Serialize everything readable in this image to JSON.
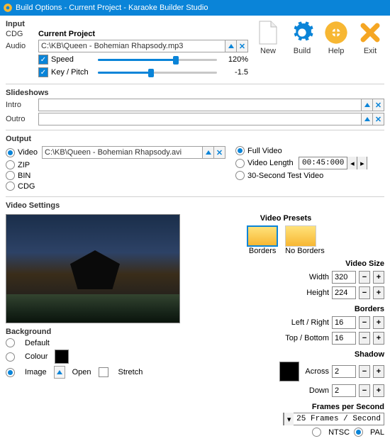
{
  "window": {
    "title": "Build Options - Current Project - Karaoke Builder Studio"
  },
  "toolbar": {
    "new": "New",
    "build": "Build",
    "help": "Help",
    "exit": "Exit"
  },
  "input": {
    "section": "Input",
    "cdg_label": "CDG",
    "project": "Current Project",
    "audio_label": "Audio",
    "audio_path": "C:\\KB\\Queen - Bohemian Rhapsody.mp3",
    "speed_label": "Speed",
    "speed_value": "120%",
    "key_label": "Key / Pitch",
    "key_value": "-1.5"
  },
  "slideshows": {
    "section": "Slideshows",
    "intro_label": "Intro",
    "outro_label": "Outro"
  },
  "output": {
    "section": "Output",
    "video_label": "Video",
    "video_path": "C:\\KB\\Queen - Bohemian Rhapsody.avi",
    "zip_label": "ZIP",
    "bin_label": "BIN",
    "cdg_label": "CDG",
    "full_video": "Full Video",
    "video_length": "Video Length",
    "time": "00:45:000",
    "test_video": "30-Second Test Video"
  },
  "video_settings": {
    "section": "Video Settings",
    "presets_label": "Video Presets",
    "preset_borders": "Borders",
    "preset_noborders": "No Borders",
    "size_label": "Video Size",
    "width_label": "Width",
    "width": "320",
    "height_label": "Height",
    "height": "224",
    "borders_label": "Borders",
    "lr_label": "Left / Right",
    "lr": "16",
    "tb_label": "Top / Bottom",
    "tb": "16",
    "shadow_label": "Shadow",
    "across_label": "Across",
    "across": "2",
    "down_label": "Down",
    "down": "2",
    "fps_label": "Frames per Second",
    "fps_value": "25 Frames / Second",
    "ntsc": "NTSC",
    "pal": "PAL"
  },
  "background": {
    "section": "Background",
    "default": "Default",
    "colour": "Colour",
    "image": "Image",
    "open": "Open",
    "stretch": "Stretch"
  }
}
